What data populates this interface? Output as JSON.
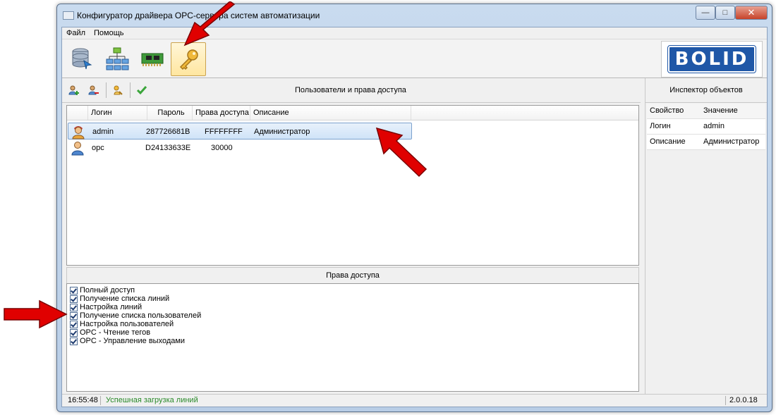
{
  "window": {
    "title": "Конфигуратор драйвера OPC-сервера систем автоматизации"
  },
  "menu": {
    "items": [
      "Файл",
      "Помощь"
    ]
  },
  "toolbar": {
    "buttons": [
      {
        "icon": "database-icon"
      },
      {
        "icon": "network-tree-icon"
      },
      {
        "icon": "circuit-board-icon"
      },
      {
        "icon": "key-icon",
        "active": true
      }
    ]
  },
  "logo": {
    "text": "BOLID"
  },
  "users_panel": {
    "title": "Пользователи и права доступа",
    "columns": [
      "Логин",
      "Пароль",
      "Права доступа",
      "Описание"
    ],
    "rows": [
      {
        "login": "admin",
        "password": "287726681B",
        "rights": "FFFFFFFF",
        "description": "Администратор",
        "selected": true
      },
      {
        "login": "opc",
        "password": "D24133633E",
        "rights": "30000",
        "description": "",
        "selected": false
      }
    ]
  },
  "rights_panel": {
    "title": "Права доступа",
    "items": [
      {
        "label": "Полный доступ",
        "checked": true
      },
      {
        "label": "Получение списка линий",
        "checked": true
      },
      {
        "label": "Настройка линий",
        "checked": true
      },
      {
        "label": "Получение списка пользователей",
        "checked": true
      },
      {
        "label": "Настройка пользователей",
        "checked": true
      },
      {
        "label": "OPC - Чтение тегов",
        "checked": true
      },
      {
        "label": "OPC - Управление выходами",
        "checked": true
      }
    ]
  },
  "inspector": {
    "title": "Инспектор объектов",
    "headers": [
      "Свойство",
      "Значение"
    ],
    "rows": [
      {
        "property": "Логин",
        "value": "admin"
      },
      {
        "property": "Описание",
        "value": "Администратор"
      }
    ]
  },
  "status": {
    "time": "16:55:48",
    "message": "Успешная загрузка линий",
    "version": "2.0.0.18"
  },
  "colors": {
    "status_message": "#2a8a2a",
    "selection": "#cfe3f8",
    "arrow": "#e00000",
    "brand": "#1f57a7"
  }
}
